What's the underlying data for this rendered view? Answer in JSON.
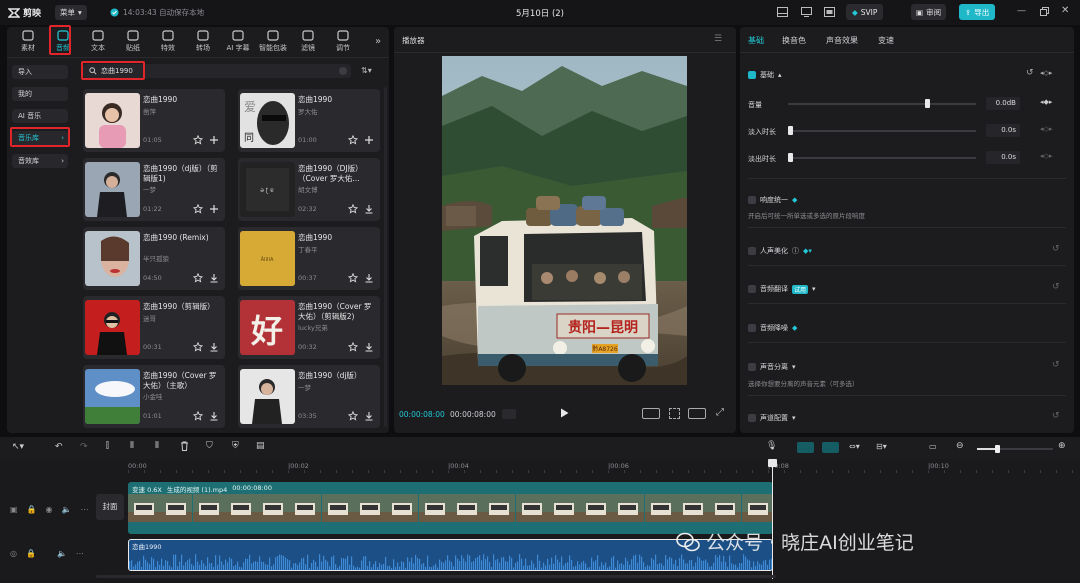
{
  "app": {
    "logo_text": "剪映",
    "menu_label": "菜单",
    "autosave": "14:03:43 自动保存本地",
    "project_title": "5月10日 (2)",
    "svip": "SVIP",
    "review": "审阅",
    "export": "导出"
  },
  "toolbar_tabs": [
    {
      "label": "素材",
      "icon": "media-icon"
    },
    {
      "label": "音频",
      "icon": "audio-icon"
    },
    {
      "label": "文本",
      "icon": "text-icon"
    },
    {
      "label": "贴纸",
      "icon": "sticker-icon"
    },
    {
      "label": "特效",
      "icon": "effects-icon"
    },
    {
      "label": "转场",
      "icon": "transition-icon"
    },
    {
      "label": "AI 字幕",
      "icon": "ai-caption-icon"
    },
    {
      "label": "智能包装",
      "icon": "smart-pack-icon"
    },
    {
      "label": "滤镜",
      "icon": "filter-icon"
    },
    {
      "label": "调节",
      "icon": "adjust-icon"
    }
  ],
  "sidebar": [
    {
      "label": "导入"
    },
    {
      "label": "我的"
    },
    {
      "label": "AI 音乐"
    },
    {
      "label": "音乐库"
    },
    {
      "label": "音效库"
    }
  ],
  "search": {
    "value": "恋曲1990"
  },
  "songs": [
    {
      "title": "恋曲1990",
      "artist": "凿萍",
      "duration": "01:05",
      "action": "add"
    },
    {
      "title": "恋曲1990",
      "artist": "罗大佑",
      "duration": "01:00",
      "action": "add"
    },
    {
      "title": "恋曲1990（dj版）（剪辑版1)",
      "artist": "一梦",
      "duration": "01:22",
      "action": "add"
    },
    {
      "title": "恋曲1990（DJ版）（Cover 罗大佑...",
      "artist": "胡文博",
      "duration": "02:32",
      "action": "download"
    },
    {
      "title": "恋曲1990 (Remix)",
      "artist": "半只孤狼",
      "duration": "04:50",
      "action": "download"
    },
    {
      "title": "恋曲1990",
      "artist": "丁春平",
      "duration": "00:37",
      "action": "download"
    },
    {
      "title": "恋曲1990（剪辑版）",
      "artist": "迷哥",
      "duration": "00:31",
      "action": "download"
    },
    {
      "title": "恋曲1990（Cover 罗大佑）（剪辑版2)",
      "artist": "lucky兄弟",
      "duration": "00:32",
      "action": "download"
    },
    {
      "title": "恋曲1990（Cover 罗大佑）（主歌）",
      "artist": "小金哇",
      "duration": "01:01",
      "action": "download"
    },
    {
      "title": "恋曲1990（dj版）",
      "artist": "一梦",
      "duration": "03:35",
      "action": "download"
    }
  ],
  "player": {
    "title": "播放器",
    "current_time": "00:00:08:00",
    "total_time": "00:00:08:00",
    "bus_sign": "贵阳—昆明",
    "plate": "黔A8726"
  },
  "props": {
    "tabs": [
      "基础",
      "换音色",
      "声音效果",
      "变速"
    ],
    "basic_title": "基础",
    "volume_label": "音量",
    "volume_value": "0.0dB",
    "volume_level": 0.74,
    "fadein_label": "淡入时长",
    "fadein_value": "0.0s",
    "fadeout_label": "淡出时长",
    "fadeout_value": "0.0s",
    "loudness_title": "响度统一",
    "loudness_desc": "开启后可统一所单选或多选的原片段响度",
    "voice_beauty": "人声美化",
    "translate": "音频翻译",
    "trial_badge": "试用",
    "denoise": "音频降噪",
    "separation": "声音分离",
    "separation_desc": "选择你想要分离的声音元素（可多选）",
    "channel": "声道配置"
  },
  "timeline": {
    "ruler": [
      "00:00",
      "|00:02",
      "|00:04",
      "|00:06",
      "|00:08",
      "|00:10"
    ],
    "video_clip": {
      "speed": "变速 0.6X",
      "name": "生成的视频 (1).mp4",
      "duration": "00:00:08:00"
    },
    "cover_label": "封面",
    "audio_clip": {
      "name": "恋曲1990"
    },
    "watermark": "公众号 · 晓庄AI创业笔记"
  },
  "colors": {
    "accent": "#22c8d6",
    "highlight": "#e0252b",
    "video_track": "#1d6f73",
    "audio_track": "#1c4f86"
  }
}
